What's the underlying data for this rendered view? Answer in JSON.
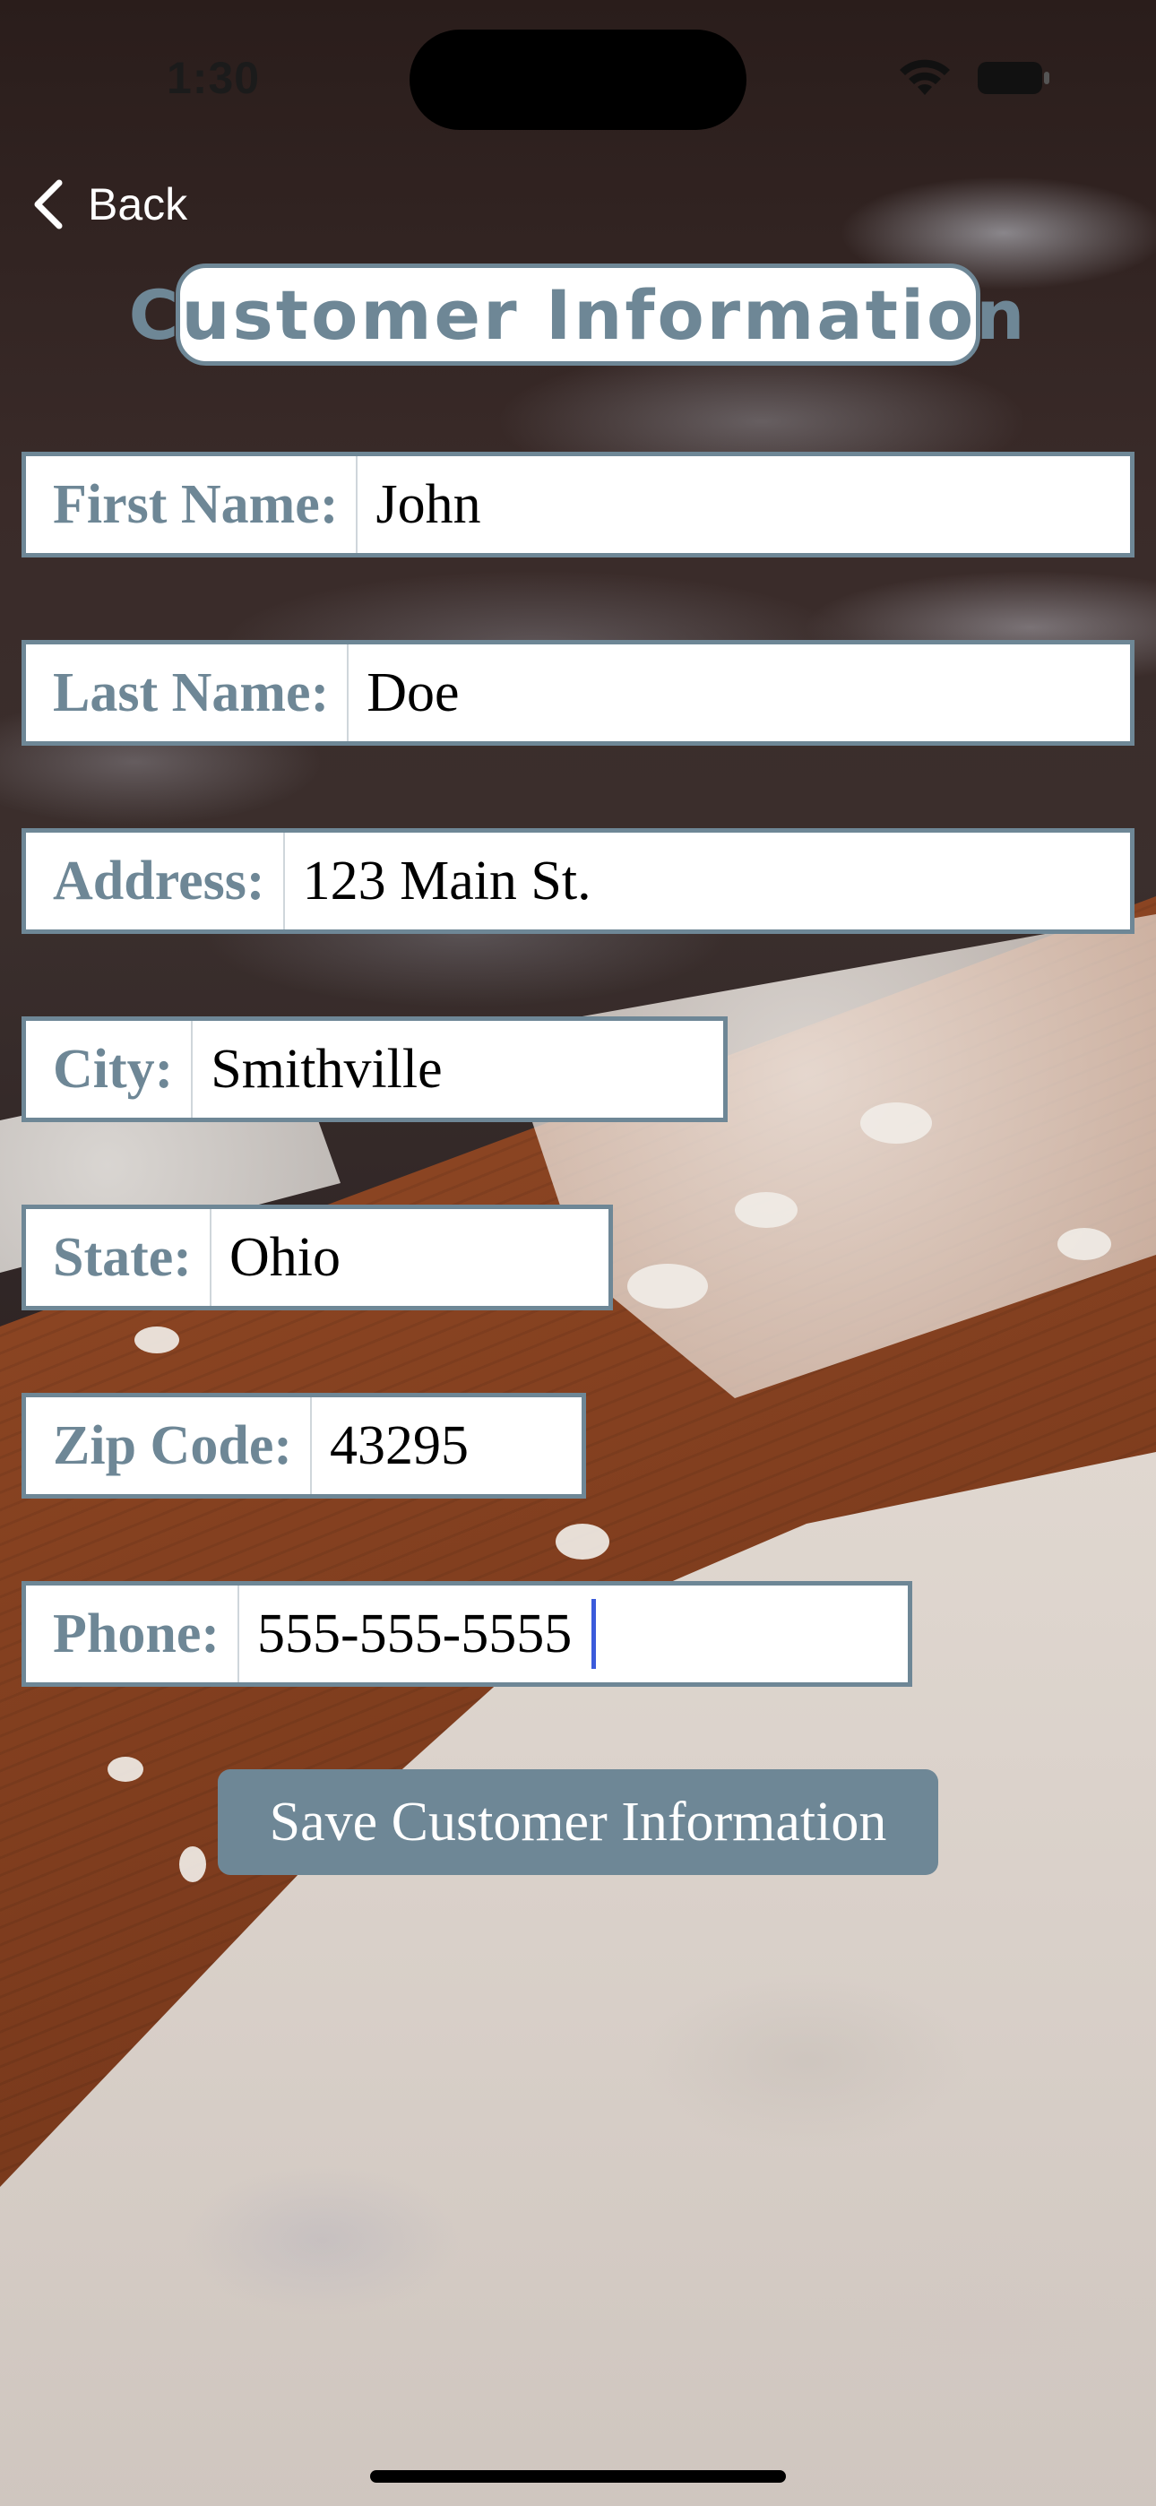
{
  "status_bar": {
    "time": "1:30",
    "wifi_icon": "wifi-icon",
    "battery_icon": "battery-icon"
  },
  "nav": {
    "back_label": "Back",
    "back_icon": "chevron-left-icon"
  },
  "header": {
    "title": "Customer Information",
    "accent_color": "#6e8796"
  },
  "form": {
    "fields": [
      {
        "label": "First Name:",
        "value": "John"
      },
      {
        "label": "Last Name:",
        "value": "Doe"
      },
      {
        "label": "Address:",
        "value": "123 Main St."
      },
      {
        "label": "City:",
        "value": "Smithville"
      },
      {
        "label": "State:",
        "value": "Ohio"
      },
      {
        "label": "Zip Code:",
        "value": "43295"
      },
      {
        "label": "Phone:",
        "value": "555-555-5555"
      }
    ],
    "focused_field": "Phone:",
    "save_label": "Save Customer Information"
  }
}
